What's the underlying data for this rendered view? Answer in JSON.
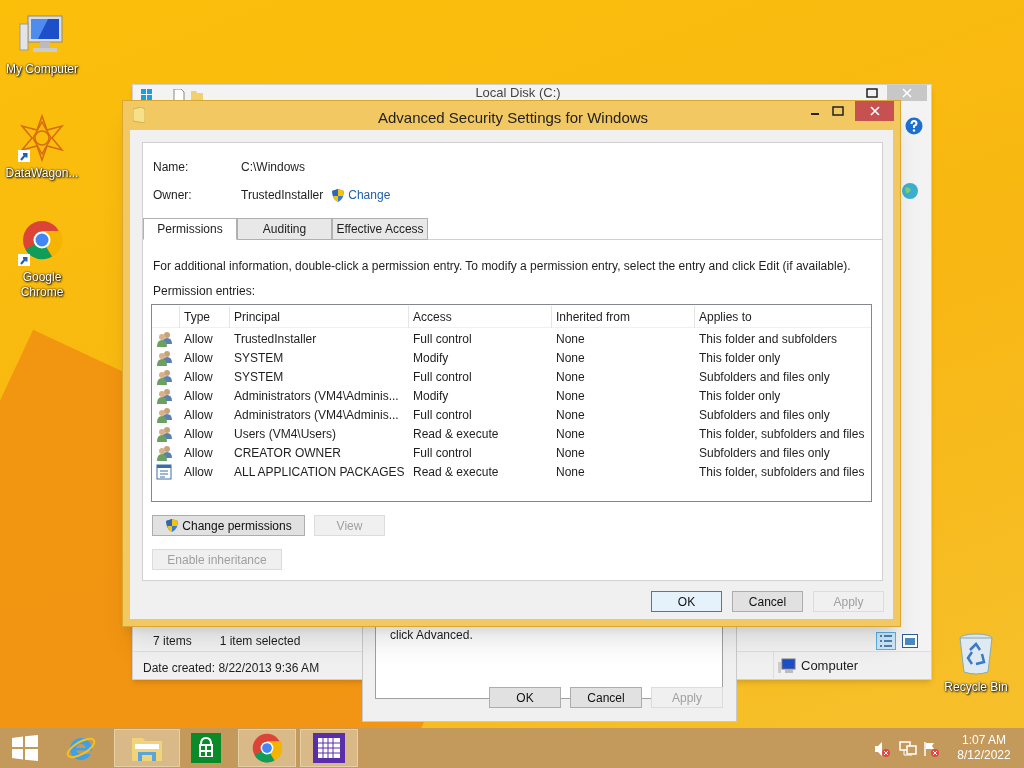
{
  "desktop_icons": [
    {
      "label": "My Computer",
      "kind": "computer"
    },
    {
      "label": "DataWagon...",
      "kind": "star"
    },
    {
      "label": "Google Chrome",
      "kind": "chrome"
    },
    {
      "label": "Recycle Bin",
      "kind": "bin"
    }
  ],
  "explorer": {
    "title": "Local Disk (C:)",
    "item_count": "7 items",
    "selection": "1 item selected",
    "date_created": "Date created: 8/22/2013 9:36 AM",
    "location": "Computer"
  },
  "properties_dialog": {
    "text": "click Advanced.",
    "buttons": [
      {
        "label": "OK",
        "disabled": false
      },
      {
        "label": "Cancel",
        "disabled": false
      },
      {
        "label": "Apply",
        "disabled": true
      }
    ]
  },
  "dialog": {
    "title": "Advanced Security Settings for Windows",
    "name_label": "Name:",
    "name_value": "C:\\Windows",
    "owner_label": "Owner:",
    "owner_value": "TrustedInstaller",
    "owner_change": "Change",
    "tabs": [
      {
        "label": "Permissions",
        "selected": true
      },
      {
        "label": "Auditing",
        "selected": false
      },
      {
        "label": "Effective Access",
        "selected": false
      }
    ],
    "info": "For additional information, double-click a permission entry. To modify a permission entry, select the entry and click Edit (if available).",
    "entries_label": "Permission entries:",
    "columns": [
      "Type",
      "Principal",
      "Access",
      "Inherited from",
      "Applies to"
    ],
    "rows": [
      {
        "kind": "group",
        "type": "Allow",
        "principal": "TrustedInstaller",
        "access": "Full control",
        "inherited_from": "None",
        "applies_to": "This folder and subfolders"
      },
      {
        "kind": "group",
        "type": "Allow",
        "principal": "SYSTEM",
        "access": "Modify",
        "inherited_from": "None",
        "applies_to": "This folder only"
      },
      {
        "kind": "group",
        "type": "Allow",
        "principal": "SYSTEM",
        "access": "Full control",
        "inherited_from": "None",
        "applies_to": "Subfolders and files only"
      },
      {
        "kind": "group",
        "type": "Allow",
        "principal": "Administrators (VM4\\Adminis...",
        "access": "Modify",
        "inherited_from": "None",
        "applies_to": "This folder only"
      },
      {
        "kind": "group",
        "type": "Allow",
        "principal": "Administrators (VM4\\Adminis...",
        "access": "Full control",
        "inherited_from": "None",
        "applies_to": "Subfolders and files only"
      },
      {
        "kind": "group",
        "type": "Allow",
        "principal": "Users (VM4\\Users)",
        "access": "Read & execute",
        "inherited_from": "None",
        "applies_to": "This folder, subfolders and files"
      },
      {
        "kind": "group",
        "type": "Allow",
        "principal": "CREATOR OWNER",
        "access": "Full control",
        "inherited_from": "None",
        "applies_to": "Subfolders and files only"
      },
      {
        "kind": "package",
        "type": "Allow",
        "principal": "ALL APPLICATION PACKAGES",
        "access": "Read & execute",
        "inherited_from": "None",
        "applies_to": "This folder, subfolders and files"
      }
    ],
    "action_buttons": [
      {
        "label": "Change permissions",
        "disabled": false,
        "shield": true
      },
      {
        "label": "View",
        "disabled": true,
        "shield": false
      }
    ],
    "inheritance_button": {
      "label": "Enable inheritance",
      "disabled": true
    },
    "buttons": [
      {
        "label": "OK",
        "disabled": false,
        "default": true
      },
      {
        "label": "Cancel",
        "disabled": false,
        "default": false
      },
      {
        "label": "Apply",
        "disabled": true,
        "default": false
      }
    ]
  },
  "taskbar": {
    "items": [
      {
        "kind": "start",
        "active": false
      },
      {
        "kind": "ie",
        "active": false
      },
      {
        "kind": "explorer",
        "active": true
      },
      {
        "kind": "store",
        "active": false
      },
      {
        "kind": "chrome",
        "active": true
      },
      {
        "kind": "calendar",
        "active": true
      }
    ],
    "time": "1:07 AM",
    "date": "8/12/2022"
  }
}
